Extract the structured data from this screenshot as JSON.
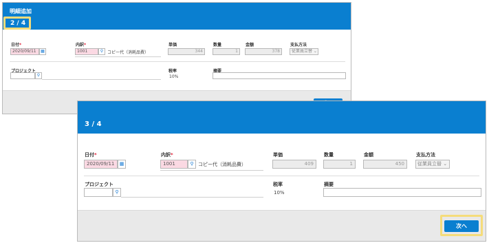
{
  "dialog_back": {
    "title": "明細追加",
    "step": "2 / 4",
    "labels": {
      "date": "日付",
      "item": "内訳",
      "unit_price": "単価",
      "quantity": "数量",
      "amount": "金額",
      "payment": "支払方法",
      "project": "プロジェクト",
      "tax_rate": "税率",
      "memo": "摘要"
    },
    "required_mark": "*",
    "date_value": "2020/09/11",
    "item_code": "1001",
    "item_name": "コピー代（消耗品費）",
    "unit_price_value": "344",
    "quantity_value": "1",
    "amount_value": "378",
    "payment_value": "従業員立替",
    "tax_rate_value": "10%",
    "next_button": "次へ"
  },
  "dialog_front": {
    "step": "3 / 4",
    "labels": {
      "date": "日付",
      "item": "内訳",
      "unit_price": "単価",
      "quantity": "数量",
      "amount": "金額",
      "payment": "支払方法",
      "project": "プロジェクト",
      "tax_rate": "税率",
      "memo": "摘要"
    },
    "required_mark": "*",
    "date_value": "2020/09/11",
    "item_code": "1001",
    "item_name": "コピー代（消耗品費）",
    "unit_price_value": "409",
    "quantity_value": "1",
    "amount_value": "450",
    "payment_value": "従業員立替",
    "tax_rate_value": "10%",
    "next_button": "次へ"
  },
  "colors": {
    "header": "#0a7fd0",
    "highlight": "#f5dc7a",
    "required_bg": "#fbd9e3"
  },
  "icons": {
    "calendar": "calendar-icon",
    "search": "search-icon",
    "dropdown": "chevron-down-icon"
  }
}
